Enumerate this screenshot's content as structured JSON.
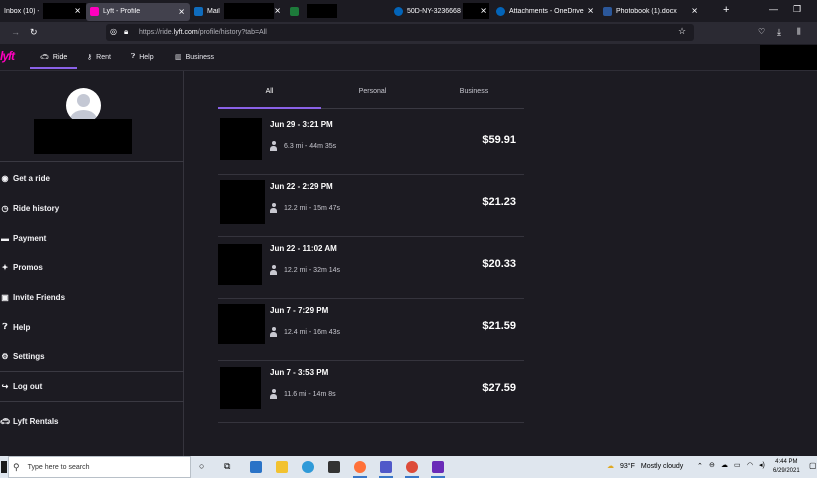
{
  "browser": {
    "tabs": [
      {
        "title": "Inbox (10) -",
        "color": "#0078d4"
      },
      {
        "title": "Lyft - Profile",
        "color": "#ff00bf",
        "active": true
      },
      {
        "title": "Mail",
        "color": "#0f6cbd"
      },
      {
        "title": "",
        "color": "#1d7a3a"
      },
      {
        "title": "50D-NY-3236668",
        "color": "#0364b8"
      },
      {
        "title": "Attachments - OneDrive",
        "color": "#0364b8"
      },
      {
        "title": "Photobook (1).docx",
        "color": "#2b579a"
      }
    ],
    "url_prefix": "https://ride.",
    "url_host": "lyft.com",
    "url_path": "/profile/history?tab=All"
  },
  "lyft": {
    "logo": "lyft",
    "nav": [
      {
        "label": "Ride",
        "icon": "car-icon"
      },
      {
        "label": "Rent",
        "icon": "key-icon"
      },
      {
        "label": "Help",
        "icon": "help-icon"
      },
      {
        "label": "Business",
        "icon": "briefcase-icon"
      }
    ]
  },
  "sidebar": {
    "items": [
      {
        "label": "Get a ride",
        "icon": "locator-icon"
      },
      {
        "label": "Ride history",
        "icon": "history-icon"
      },
      {
        "label": "Payment",
        "icon": "card-icon"
      },
      {
        "label": "Promos",
        "icon": "tag-icon"
      },
      {
        "label": "Invite Friends",
        "icon": "gift-icon"
      },
      {
        "label": "Help",
        "icon": "help-icon"
      },
      {
        "label": "Settings",
        "icon": "gear-icon"
      },
      {
        "label": "Log out",
        "icon": "logout-icon"
      },
      {
        "label": "Lyft Rentals",
        "icon": "car-icon"
      }
    ]
  },
  "history": {
    "tabs": [
      "All",
      "Personal",
      "Business"
    ],
    "active_tab": "All",
    "rides": [
      {
        "when": "Jun 29 - 3:21 PM",
        "meta": "6.3 mi - 44m 35s",
        "price": "$59.91"
      },
      {
        "when": "Jun 22 - 2:29 PM",
        "meta": "12.2 mi - 15m 47s",
        "price": "$21.23"
      },
      {
        "when": "Jun 22 - 11:02 AM",
        "meta": "12.2 mi - 32m 14s",
        "price": "$20.33"
      },
      {
        "when": "Jun 7 - 7:29 PM",
        "meta": "12.4 mi - 16m 43s",
        "price": "$21.59"
      },
      {
        "when": "Jun 7 - 3:53 PM",
        "meta": "11.6 mi - 14m 8s",
        "price": "$27.59"
      }
    ]
  },
  "taskbar": {
    "search_placeholder": "Type here to search",
    "temp": "93°F",
    "weather": "Mostly cloudy",
    "time": "4:44 PM",
    "date": "6/29/2021"
  },
  "accent": "#8a62e8",
  "brand": "#ff00bf"
}
